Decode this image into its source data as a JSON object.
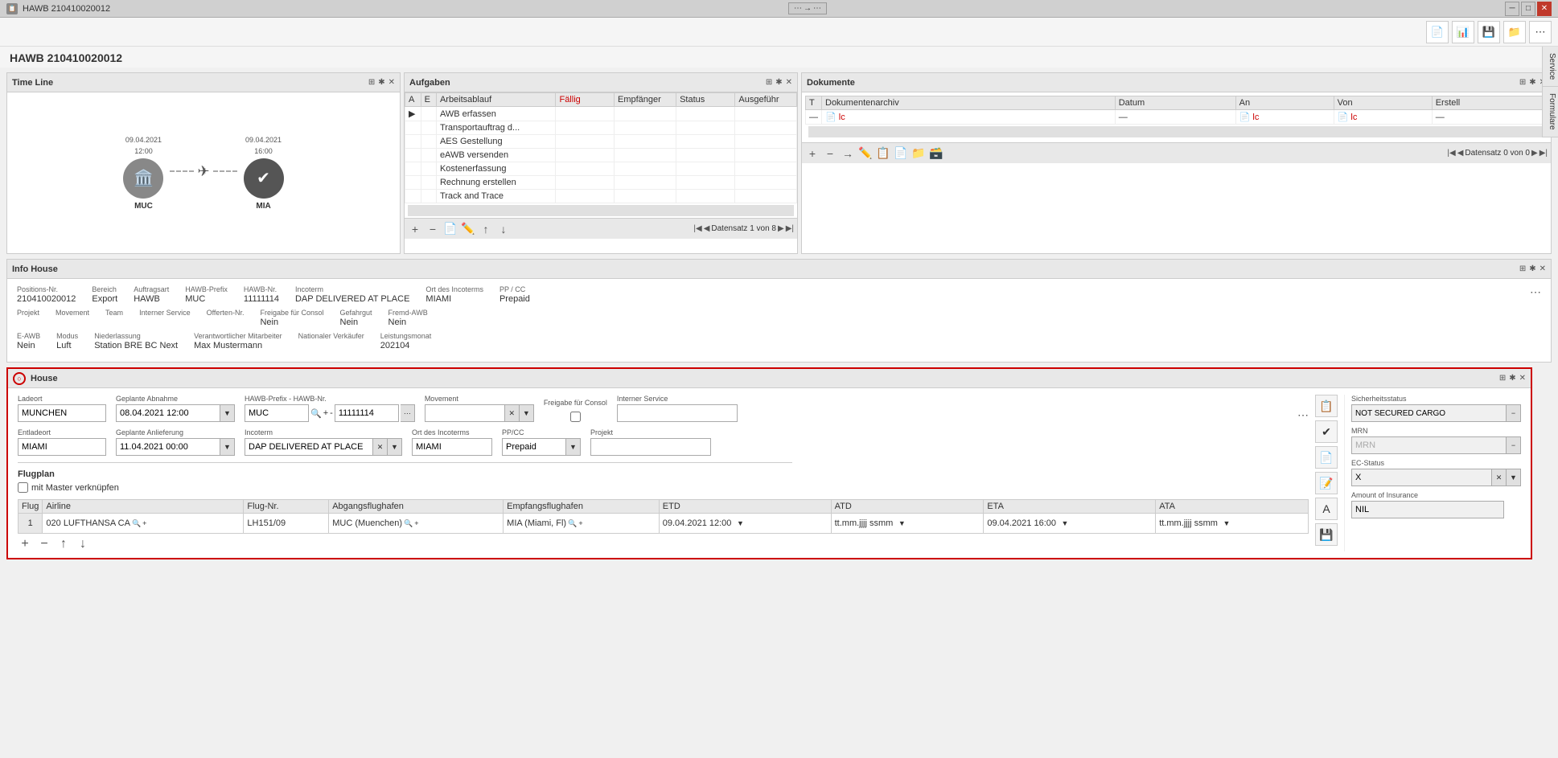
{
  "titleBar": {
    "title": "HAWB 210410020012",
    "icon": "📋"
  },
  "toolbar": {
    "buttons": [
      "📄",
      "📊",
      "💾",
      "📁",
      "⋯"
    ]
  },
  "pageTitle": "HAWB 210410020012",
  "rightSidebar": {
    "tabs": [
      "Service",
      "Formulare"
    ]
  },
  "timeline": {
    "title": "Time Line",
    "from": {
      "code": "MUC",
      "date": "09.04.2021",
      "time": "12:00"
    },
    "to": {
      "code": "MIA",
      "date": "09.04.2021",
      "time": "16:00"
    }
  },
  "aufgaben": {
    "title": "Aufgaben",
    "columns": [
      "A",
      "E",
      "Arbeitsablauf",
      "Fällig",
      "Empfänger",
      "Status",
      "Ausgeführ"
    ],
    "rows": [
      {
        "a": "",
        "e": "",
        "ab": "AWB erfassen",
        "fal": "",
        "emp": "",
        "st": "",
        "aus": ""
      },
      {
        "a": "",
        "e": "",
        "ab": "Transportauftrag d...",
        "fal": "",
        "emp": "",
        "st": "",
        "aus": ""
      },
      {
        "a": "",
        "e": "",
        "ab": "AES Gestellung",
        "fal": "",
        "emp": "",
        "st": "",
        "aus": ""
      },
      {
        "a": "",
        "e": "",
        "ab": "eAWB versenden",
        "fal": "",
        "emp": "",
        "st": "",
        "aus": ""
      },
      {
        "a": "",
        "e": "",
        "ab": "Kostenerfassung",
        "fal": "",
        "emp": "",
        "st": "",
        "aus": ""
      },
      {
        "a": "",
        "e": "",
        "ab": "Rechnung erstellen",
        "fal": "",
        "emp": "",
        "st": "",
        "aus": ""
      },
      {
        "a": "",
        "e": "",
        "ab": "Track and Trace",
        "fal": "",
        "emp": "",
        "st": "",
        "aus": ""
      }
    ],
    "pagination": "Datensatz 1 von 8"
  },
  "dokumente": {
    "title": "Dokumente",
    "columns": [
      "Dokumentenarchiv",
      "Datum",
      "An",
      "Von",
      "Erstell"
    ],
    "pagination": "Datensatz 0 von 0"
  },
  "infoHouse": {
    "title": "Info House",
    "fields": {
      "positionsNr": {
        "label": "Positions-Nr.",
        "value": "210410020012"
      },
      "bereich": {
        "label": "Bereich",
        "value": "Export"
      },
      "auftragsart": {
        "label": "Auftragsart",
        "value": "HAWB"
      },
      "hawbPrefix": {
        "label": "HAWB-Prefix",
        "value": "MUC"
      },
      "hawbNr": {
        "label": "HAWB-Nr.",
        "value": "11111114"
      },
      "incoterm": {
        "label": "Incoterm",
        "value": "DAP DELIVERED AT PLACE"
      },
      "ortDesIncoterms": {
        "label": "Ort des Incoterms",
        "value": "MIAMI"
      },
      "ppCc": {
        "label": "PP / CC",
        "value": "Prepaid"
      },
      "projekt": {
        "label": "Projekt",
        "value": ""
      },
      "movement": {
        "label": "Movement",
        "value": ""
      },
      "team": {
        "label": "Team",
        "value": ""
      },
      "internerService": {
        "label": "Interner Service",
        "value": ""
      },
      "offertenNr": {
        "label": "Offerten-Nr.",
        "value": ""
      },
      "freigabeFuerConsol": {
        "label": "Freigabe für Consol",
        "value": "Nein"
      },
      "gefahrgut": {
        "label": "Gefahrgut",
        "value": "Nein"
      },
      "fremdAWB": {
        "label": "Fremd-AWB",
        "value": "Nein"
      },
      "eAWB": {
        "label": "E-AWB",
        "value": "Nein"
      },
      "modus": {
        "label": "Modus",
        "value": "Luft"
      },
      "niederlassung": {
        "label": "Niederlassung",
        "value": "Station BRE BC Next"
      },
      "verantwortlicherMitarbeiter": {
        "label": "Verantwortlicher Mitarbeiter",
        "value": "Max Mustermann"
      },
      "nationalerVerkaufer": {
        "label": "Nationaler Verkäufer",
        "value": ""
      },
      "leistungsmonat": {
        "label": "Leistungsmonat",
        "value": "202104"
      }
    }
  },
  "house": {
    "title": "House",
    "ladeort": {
      "label": "Ladeort",
      "value": "MUNCHEN"
    },
    "geplante_abnahme": {
      "label": "Geplante Abnahme",
      "value": "08.04.2021 12:00"
    },
    "hawb_prefix": {
      "label": "HAWB-Prefix - HAWB-Nr.",
      "prefix": "MUC",
      "nr": "11111114"
    },
    "movement": {
      "label": "Movement",
      "value": ""
    },
    "freigabe_consol": {
      "label": "Freigabe für Consol",
      "checked": false
    },
    "interner_service": {
      "label": "Interner Service",
      "value": ""
    },
    "entladeort": {
      "label": "Entladeort",
      "value": "MIAMI"
    },
    "geplante_anlieferung": {
      "label": "Geplante Anlieferung",
      "value": "11.04.2021 00:00"
    },
    "incoterm": {
      "label": "Incoterm",
      "value": "DAP DELIVERED AT PLACE"
    },
    "ort_incoterms": {
      "label": "Ort des Incoterms",
      "value": "MIAMI"
    },
    "ppcc": {
      "label": "PP/CC",
      "value": "Prepaid"
    },
    "projekt": {
      "label": "Projekt",
      "value": ""
    },
    "flugplan": {
      "label": "Flugplan",
      "mit_master": "mit Master verknüpfen",
      "columns": [
        "Flug",
        "Airline",
        "Flug-Nr.",
        "Abgangsflughafen",
        "Empfangsflughafen",
        "ETD",
        "ATD",
        "ETA",
        "ATA"
      ],
      "rows": [
        {
          "flug": "1",
          "airline": "020 LUFTHANSA CA",
          "flugNr": "LH151/09",
          "abgang": "MUC (Muenchen)",
          "empfang": "MIA (Miami, Fl)",
          "etd": "09.04.2021 12:00",
          "atd": "",
          "eta": "09.04.2021 16:00",
          "ata": ""
        }
      ]
    },
    "sicherheitsstatus": {
      "label": "Sicherheitsstatus",
      "value": "NOT SECURED CARGO"
    },
    "mrn": {
      "label": "MRN",
      "value": "MRN"
    },
    "ecStatus": {
      "label": "EC-Status",
      "value": "X"
    },
    "amountOfInsurance": {
      "label": "Amount of Insurance",
      "value": "NIL"
    }
  }
}
